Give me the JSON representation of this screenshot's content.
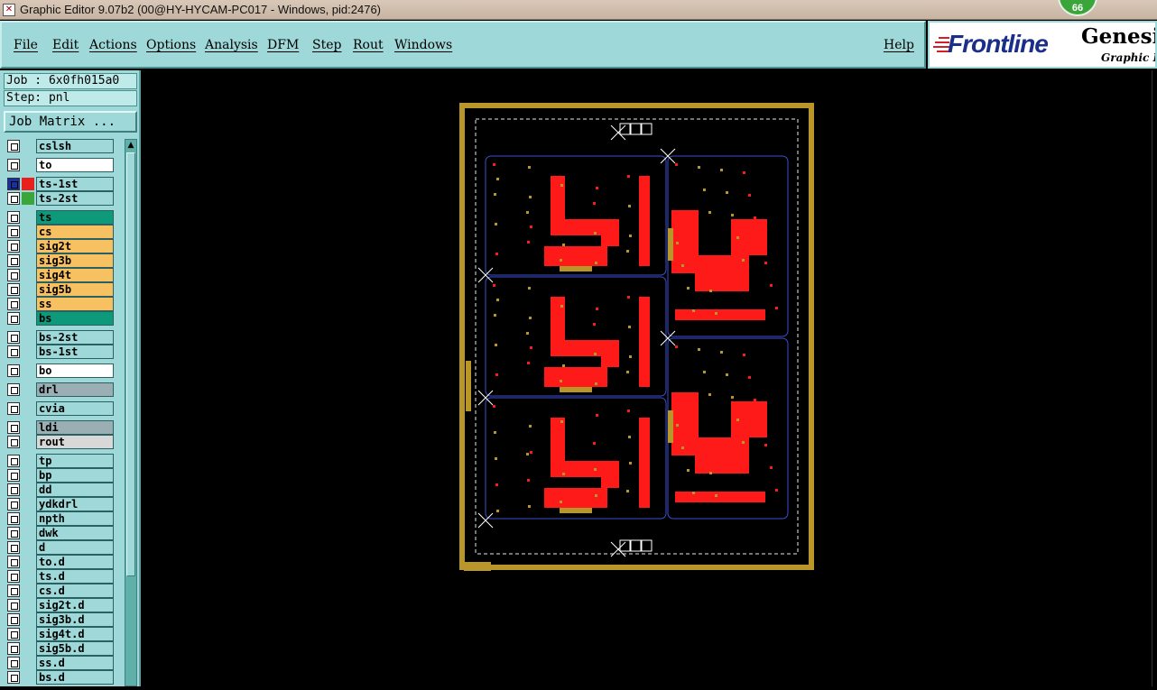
{
  "window": {
    "title": "Graphic Editor 9.07b2 (00@HY-HYCAM-PC017 - Windows, pid:2476)",
    "notification_count": "66"
  },
  "menu": {
    "items": [
      "File",
      "Edit",
      "Actions",
      "Options",
      "Analysis",
      "DFM",
      "Step",
      "Rout",
      "Windows"
    ],
    "help": "Help"
  },
  "logo": {
    "brand": "Frontline",
    "product": "Genesis",
    "subtitle": "Graphic Ed"
  },
  "job": {
    "job_text": "Job : 6x0fh015a0",
    "step_text": "Step: pnl",
    "matrix_button": "Job Matrix ..."
  },
  "layers": [
    {
      "name": "cslsh",
      "color": "#9fd8d8"
    },
    {
      "name": "to",
      "color": "#ffffff"
    },
    {
      "name": "ts-1st",
      "color": "#9fd8d8",
      "swatch": "#e8201e",
      "state": "work"
    },
    {
      "name": "ts-2st",
      "color": "#9fd8d8",
      "swatch": "#3aa63a"
    },
    {
      "name": "ts",
      "color": "#0e9a7a"
    },
    {
      "name": "cs",
      "color": "#f7c060"
    },
    {
      "name": "sig2t",
      "color": "#f7c060"
    },
    {
      "name": "sig3b",
      "color": "#f7c060"
    },
    {
      "name": "sig4t",
      "color": "#f7c060"
    },
    {
      "name": "sig5b",
      "color": "#f7c060"
    },
    {
      "name": "ss",
      "color": "#f7c060"
    },
    {
      "name": "bs",
      "color": "#0e9a7a"
    },
    {
      "name": "bs-2st",
      "color": "#9fd8d8"
    },
    {
      "name": "bs-1st",
      "color": "#9fd8d8"
    },
    {
      "name": "bo",
      "color": "#ffffff"
    },
    {
      "name": "drl",
      "color": "#9aaeb4"
    },
    {
      "name": "cvia",
      "color": "#9fd8d8"
    },
    {
      "name": "ldi",
      "color": "#9aaeb4"
    },
    {
      "name": "rout",
      "color": "#d8d8d8"
    },
    {
      "name": "tp",
      "color": "#9fd8d8"
    },
    {
      "name": "bp",
      "color": "#9fd8d8"
    },
    {
      "name": "dd",
      "color": "#9fd8d8"
    },
    {
      "name": "ydkdrl",
      "color": "#9fd8d8"
    },
    {
      "name": "npth",
      "color": "#9fd8d8"
    },
    {
      "name": "dwk",
      "color": "#9fd8d8"
    },
    {
      "name": "d",
      "color": "#9fd8d8"
    },
    {
      "name": "to.d",
      "color": "#9fd8d8"
    },
    {
      "name": "ts.d",
      "color": "#9fd8d8"
    },
    {
      "name": "cs.d",
      "color": "#9fd8d8"
    },
    {
      "name": "sig2t.d",
      "color": "#9fd8d8"
    },
    {
      "name": "sig3b.d",
      "color": "#9fd8d8"
    },
    {
      "name": "sig4t.d",
      "color": "#9fd8d8"
    },
    {
      "name": "sig5b.d",
      "color": "#9fd8d8"
    },
    {
      "name": "ss.d",
      "color": "#9fd8d8"
    },
    {
      "name": "bs.d",
      "color": "#9fd8d8"
    }
  ],
  "colors": {
    "panel": "#9fd8d8",
    "copper": "#ff1a1a",
    "frame": "#b8962a",
    "outline": "#3c4fd0"
  }
}
